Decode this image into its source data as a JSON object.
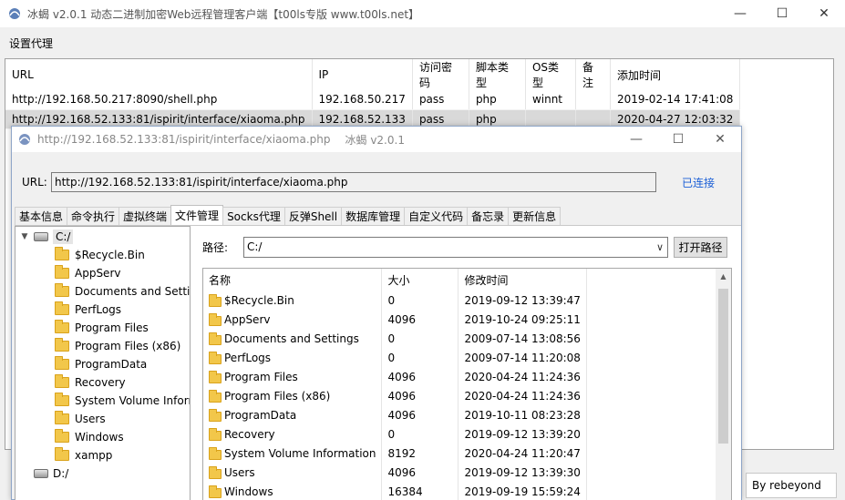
{
  "main_window": {
    "title": "冰蝎 v2.0.1 动态二进制加密Web远程管理客户端【t00ls专版 www.t00ls.net】",
    "menu_settings_proxy": "设置代理",
    "columns": [
      "URL",
      "IP",
      "访问密码",
      "脚本类型",
      "OS类型",
      "备注",
      "添加时间"
    ],
    "rows": [
      {
        "url": "http://192.168.50.217:8090/shell.php",
        "ip": "192.168.50.217",
        "password": "pass",
        "script": "php",
        "os": "winnt",
        "note": "",
        "added": "2019-02-14 17:41:08"
      },
      {
        "url": "http://192.168.52.133:81/ispirit/interface/xiaoma.php",
        "ip": "192.168.52.133",
        "password": "pass",
        "script": "php",
        "os": "",
        "note": "",
        "added": "2020-04-27 12:03:32"
      }
    ],
    "author_label": "By rebeyond"
  },
  "window_controls": {
    "minimize": "—",
    "maximize": "☐",
    "close": "✕"
  },
  "shell_window": {
    "title_url": "http://192.168.52.133:81/ispirit/interface/xiaoma.php",
    "title_app": "冰蝎 v2.0.1",
    "url_label": "URL:",
    "url_value": "http://192.168.52.133:81/ispirit/interface/xiaoma.php",
    "status": "已连接",
    "tabs": [
      "基本信息",
      "命令执行",
      "虚拟终端",
      "文件管理",
      "Socks代理",
      "反弹Shell",
      "数据库管理",
      "自定义代码",
      "备忘录",
      "更新信息"
    ],
    "active_tab": "文件管理",
    "tree": {
      "drive_c": "C:/",
      "drive_d": "D:/",
      "folders": [
        "$Recycle.Bin",
        "AppServ",
        "Documents and Settin",
        "PerfLogs",
        "Program Files",
        "Program Files (x86)",
        "ProgramData",
        "Recovery",
        "System Volume Inform",
        "Users",
        "Windows",
        "xampp"
      ]
    },
    "path_label": "路径:",
    "path_value": "C:/",
    "open_path_button": "打开路径",
    "file_columns": [
      "名称",
      "大小",
      "修改时间"
    ],
    "files": [
      {
        "name": "$Recycle.Bin",
        "size": "0",
        "modified": "2019-09-12 13:39:47"
      },
      {
        "name": "AppServ",
        "size": "4096",
        "modified": "2019-10-24 09:25:11"
      },
      {
        "name": "Documents and Settings",
        "size": "0",
        "modified": "2009-07-14 13:08:56"
      },
      {
        "name": "PerfLogs",
        "size": "0",
        "modified": "2009-07-14 11:20:08"
      },
      {
        "name": "Program Files",
        "size": "4096",
        "modified": "2020-04-24 11:24:36"
      },
      {
        "name": "Program Files (x86)",
        "size": "4096",
        "modified": "2020-04-24 11:24:36"
      },
      {
        "name": "ProgramData",
        "size": "4096",
        "modified": "2019-10-11 08:23:28"
      },
      {
        "name": "Recovery",
        "size": "0",
        "modified": "2019-09-12 13:39:20"
      },
      {
        "name": "System Volume Information",
        "size": "8192",
        "modified": "2020-04-24 11:20:47"
      },
      {
        "name": "Users",
        "size": "4096",
        "modified": "2019-09-12 13:39:30"
      },
      {
        "name": "Windows",
        "size": "16384",
        "modified": "2019-09-19 15:59:24"
      }
    ]
  }
}
